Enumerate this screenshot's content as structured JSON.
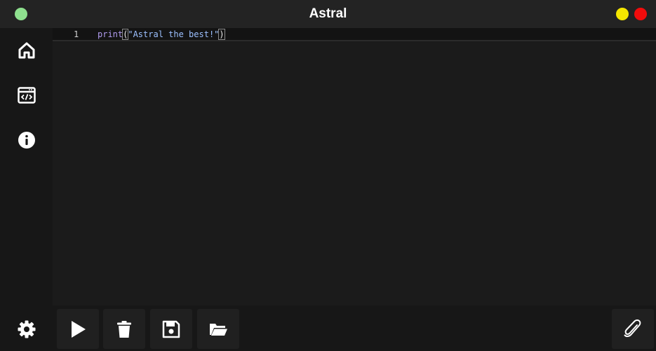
{
  "window": {
    "title": "Astral"
  },
  "traffic_lights": {
    "left": "#8ee08e",
    "minimize": "#f5e600",
    "close": "#f20c0c"
  },
  "sidebar": {
    "items": [
      {
        "icon": "home-icon"
      },
      {
        "icon": "code-window-icon"
      },
      {
        "icon": "info-icon"
      }
    ],
    "settings_icon": "gear-icon"
  },
  "editor": {
    "lines": [
      {
        "number": "1",
        "fn": "print",
        "open": "(",
        "string": "\"Astral the best!\"",
        "close": ")"
      }
    ]
  },
  "toolbar": {
    "buttons": [
      {
        "icon": "play-icon"
      },
      {
        "icon": "trash-icon"
      },
      {
        "icon": "save-icon"
      },
      {
        "icon": "folder-open-icon"
      }
    ],
    "attach_icon": "paperclip-icon"
  }
}
